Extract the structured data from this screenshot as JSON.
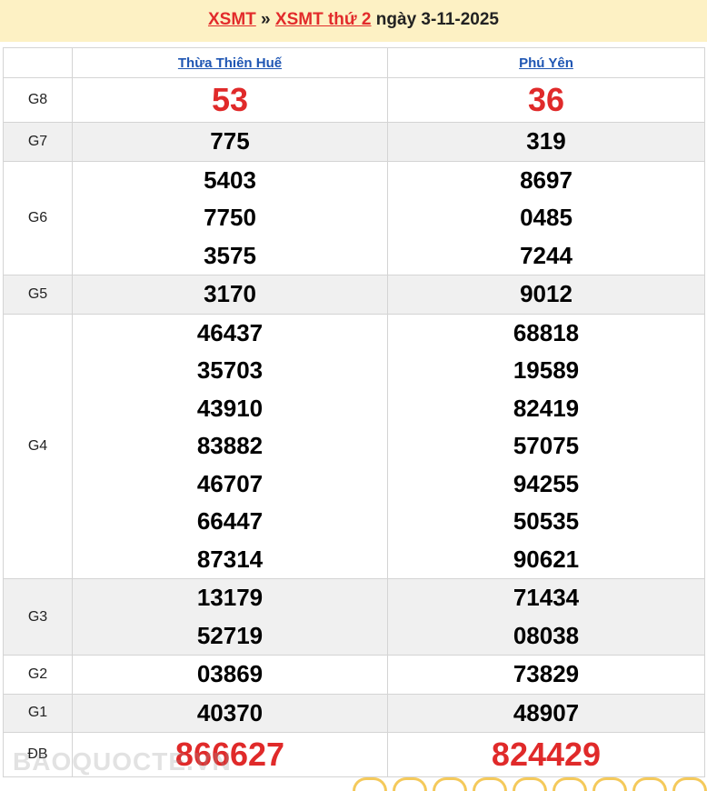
{
  "header": {
    "link1": "XSMT",
    "separator": "»",
    "link2": "XSMT thứ 2",
    "date_text": "ngày 3-11-2025"
  },
  "provinces": [
    "Thừa Thiên Huế",
    "Phú Yên"
  ],
  "rows": [
    {
      "label": "G8",
      "col1": [
        "53"
      ],
      "col2": [
        "36"
      ]
    },
    {
      "label": "G7",
      "col1": [
        "775"
      ],
      "col2": [
        "319"
      ]
    },
    {
      "label": "G6",
      "col1": [
        "5403",
        "7750",
        "3575"
      ],
      "col2": [
        "8697",
        "0485",
        "7244"
      ]
    },
    {
      "label": "G5",
      "col1": [
        "3170"
      ],
      "col2": [
        "9012"
      ]
    },
    {
      "label": "G4",
      "col1": [
        "46437",
        "35703",
        "43910",
        "83882",
        "46707",
        "66447",
        "87314"
      ],
      "col2": [
        "68818",
        "19589",
        "82419",
        "57075",
        "94255",
        "50535",
        "90621"
      ]
    },
    {
      "label": "G3",
      "col1": [
        "13179",
        "52719"
      ],
      "col2": [
        "71434",
        "08038"
      ]
    },
    {
      "label": "G2",
      "col1": [
        "03869"
      ],
      "col2": [
        "73829"
      ]
    },
    {
      "label": "G1",
      "col1": [
        "40370"
      ],
      "col2": [
        "48907"
      ]
    },
    {
      "label": "ĐB",
      "col1": [
        "866627"
      ],
      "col2": [
        "824429"
      ]
    }
  ],
  "watermark": "BAOQUOCTE.VN",
  "colors": {
    "accent_red": "#e02a2a",
    "link_blue": "#1f56b3",
    "header_bg": "#fdf1c4"
  }
}
